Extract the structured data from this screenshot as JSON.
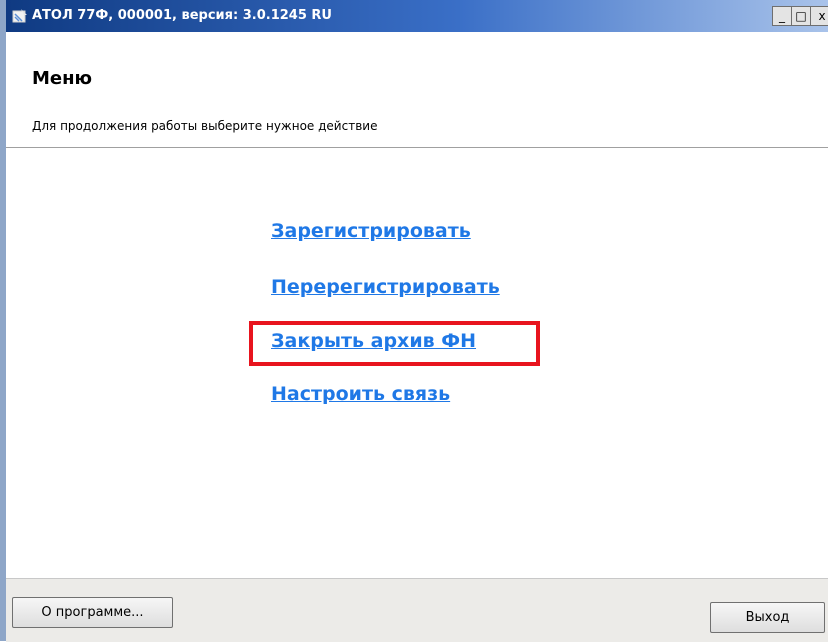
{
  "window": {
    "title": "АТОЛ 77Ф, 000001, версия: 3.0.1245 RU",
    "icon": "app-icon",
    "controls": {
      "minimize": "_",
      "maximize": "□",
      "close": "x"
    }
  },
  "header": {
    "title": "Меню",
    "subtitle": "Для продолжения работы выберите нужное действие"
  },
  "menu": {
    "items": [
      {
        "label": "Зарегистрировать"
      },
      {
        "label": "Перерегистрировать"
      },
      {
        "label": "Закрыть архив ФН",
        "highlighted": true
      },
      {
        "label": "Настроить связь"
      }
    ]
  },
  "footer": {
    "about_label": "О программе...",
    "exit_label": "Выход"
  },
  "colors": {
    "link": "#1f78e6",
    "highlight": "#e8141e",
    "titlebar": "#0f3a82"
  }
}
